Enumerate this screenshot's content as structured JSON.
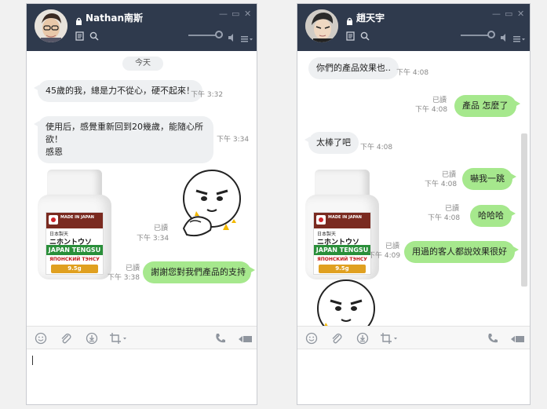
{
  "colors": {
    "titlebar": "#2f3a4d",
    "incoming_bubble": "#eef0f2",
    "outgoing_bubble": "#a6e88d"
  },
  "window1": {
    "title": "Nathan南斯",
    "date_label": "今天",
    "messages": [
      {
        "text": "45歲的我，總是力不從心，硬不起來！",
        "time": "下午 3:32"
      },
      {
        "text_line1": "使用后，感覺重新回到20幾歲，能隨心所欲！",
        "text_line2": "感恩",
        "time": "下午 3:34"
      }
    ],
    "sticker_read": "已讀",
    "sticker_time": "下午 3:34",
    "reply": {
      "text": "謝謝您對我們產品的支持",
      "read": "已讀",
      "time": "下午 3:38"
    }
  },
  "window2": {
    "title": "趙天宇",
    "messages": [
      {
        "side": "in",
        "text": "你們的產品效果也..",
        "time": "下午 4:08"
      },
      {
        "side": "out",
        "text": "產品 怎麼了",
        "read": "已讀",
        "time": "下午 4:08"
      },
      {
        "side": "in",
        "text": "太棒了吧",
        "time": "下午 4:08"
      },
      {
        "side": "out",
        "text": "嚇我一跳",
        "read": "已讀",
        "time": "下午 4:08"
      },
      {
        "side": "out",
        "text": "哈哈哈",
        "read": "已讀",
        "time": "下午 4:08"
      },
      {
        "side": "out",
        "text": "用過的客人都說效果很好",
        "read": "已讀",
        "time": "下午 4:09"
      }
    ]
  },
  "product_label": {
    "made_in": "MADE IN JAPAN",
    "small": "日本製天",
    "kana": "ニホントウソ",
    "en": "JAPAN TENGSU",
    "ru": "ЯПОНСКИЙ ТЭНСУ",
    "grams": "9.5g"
  },
  "icons": [
    "lock-icon",
    "note-icon",
    "search-icon",
    "volume-icon",
    "menu-icon",
    "emoji-icon",
    "attach-icon",
    "download-icon",
    "crop-icon",
    "call-icon",
    "video-icon"
  ]
}
